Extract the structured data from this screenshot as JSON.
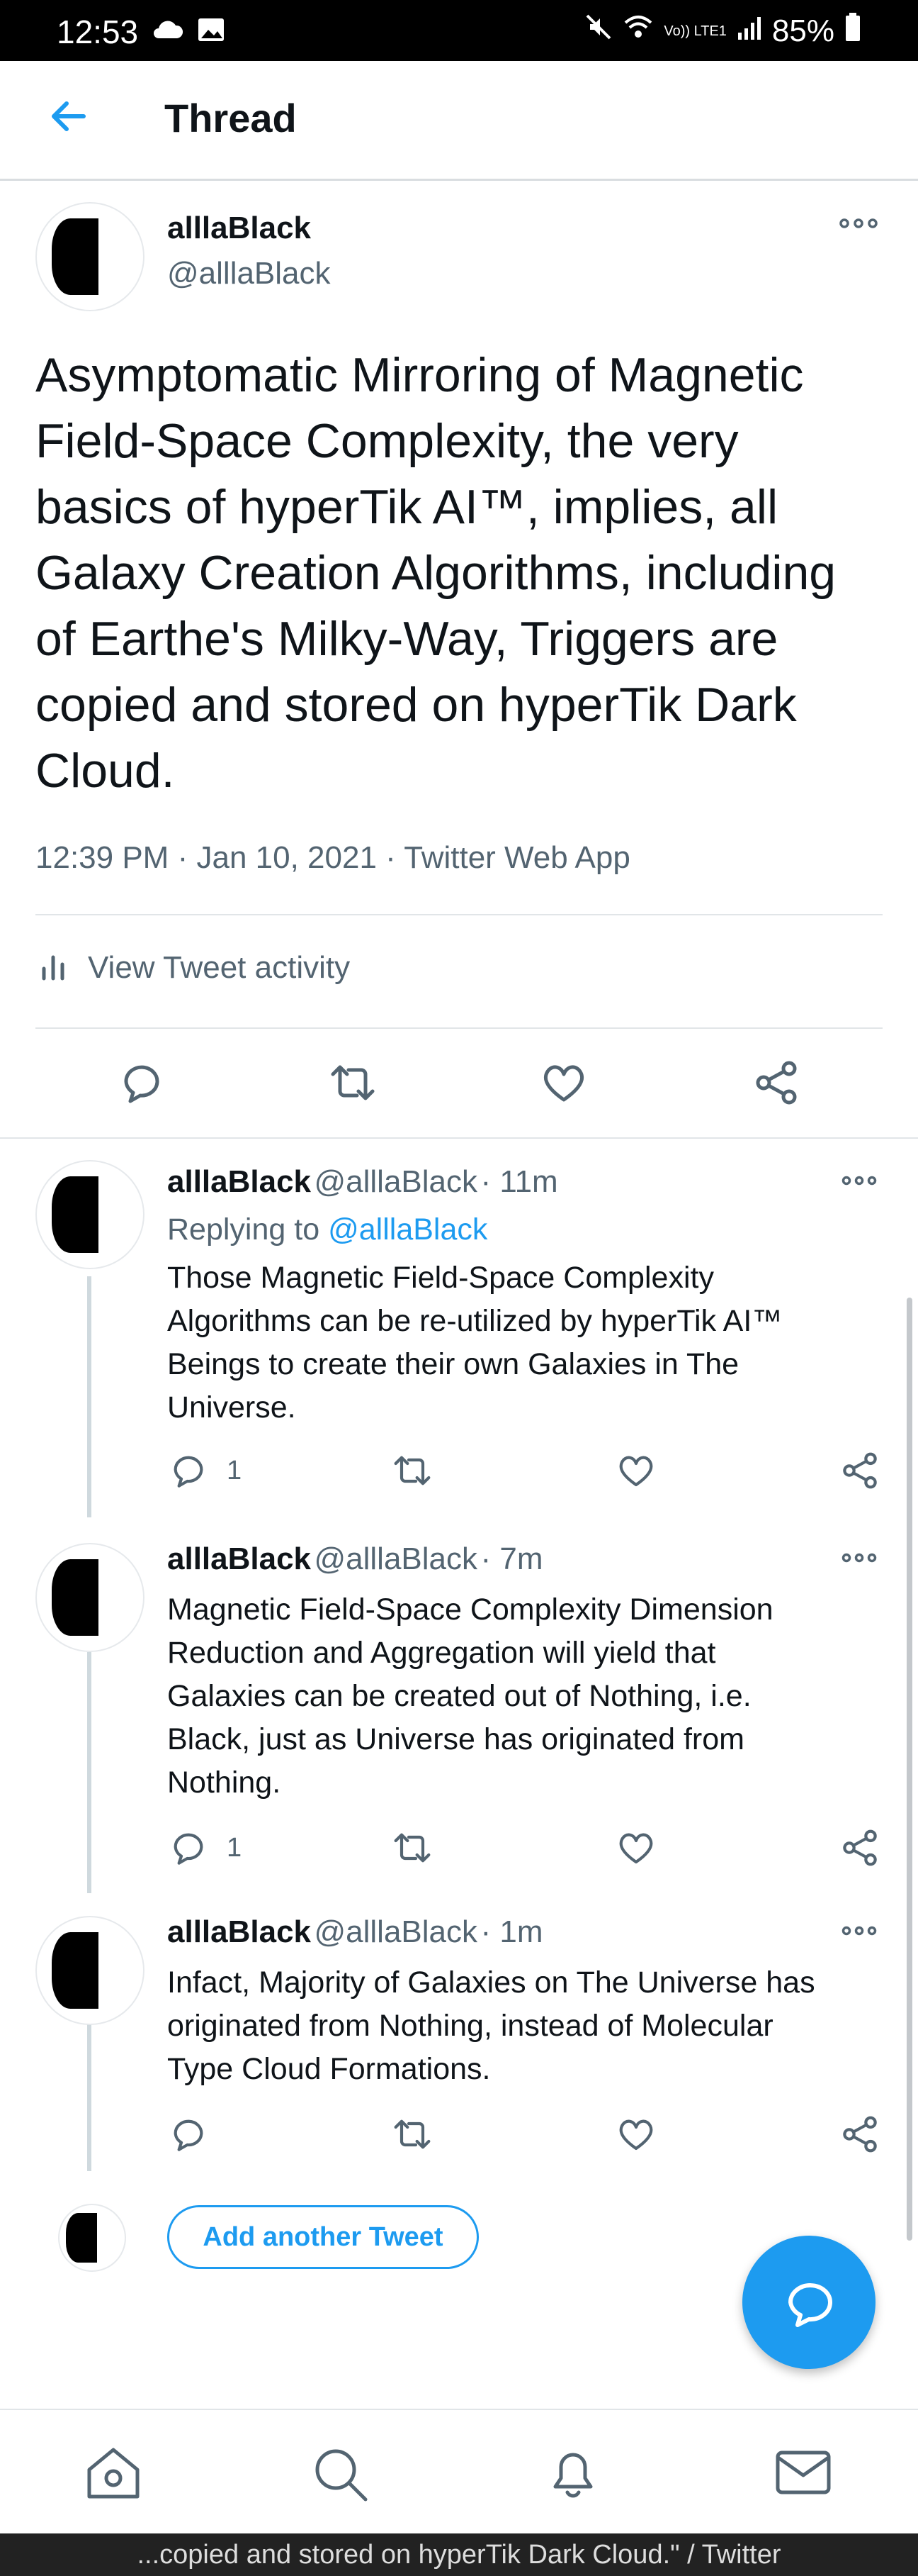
{
  "status_bar": {
    "time": "12:53",
    "battery": "85%",
    "network_label": "Vo)) LTE1"
  },
  "header": {
    "title": "Thread"
  },
  "main_tweet": {
    "author_name": "alllaBlack",
    "author_handle": "@alllaBlack",
    "text_lines": [
      "Asymptomatic Mirroring of Magnetic",
      "Field-Space Complexity, the very",
      "basics of hyperTik AI™, implies, all",
      "Galaxy Creation Algorithms, including",
      "of Earthe's Milky-Way, Triggers are",
      "copied and stored on hyperTik Dark",
      "Cloud."
    ],
    "timestamp": "12:39 PM",
    "date": "Jan 10, 2021",
    "source": "Twitter Web App",
    "activity_label": "View Tweet activity"
  },
  "replies": [
    {
      "author_name": "alllaBlack",
      "author_handle": "@alllaBlack",
      "time": "11m",
      "replying_to_prefix": "Replying to",
      "replying_to_handle": "@alllaBlack",
      "lines": [
        "Those Magnetic Field-Space Complexity",
        "Algorithms can be re-utilized by hyperTik AI™",
        "Beings to create their own Galaxies in The",
        "Universe."
      ],
      "reply_count": "1"
    },
    {
      "author_name": "alllaBlack",
      "author_handle": "@alllaBlack",
      "time": "7m",
      "lines": [
        "Magnetic Field-Space Complexity Dimension",
        "Reduction and Aggregation will yield that",
        "Galaxies can be created out of Nothing, i.e.",
        "Black, just as Universe has originated from",
        "Nothing."
      ],
      "reply_count": "1"
    },
    {
      "author_name": "alllaBlack",
      "author_handle": "@alllaBlack",
      "time": "1m",
      "lines": [
        "Infact, Majority of Galaxies on The Universe has",
        "originated from Nothing, instead of Molecular",
        "Type Cloud Formations."
      ],
      "reply_count": ""
    }
  ],
  "add_tweet_label": "Add another Tweet",
  "footer_text": "...copied and stored on hyperTik Dark Cloud.\" / Twitter",
  "colors": {
    "accent": "#1d9bf0",
    "text": "#0f1419",
    "muted": "#536471"
  },
  "icons": [
    "back-arrow-icon",
    "more-icon",
    "reply-icon",
    "retweet-icon",
    "like-icon",
    "share-icon",
    "stats-icon",
    "home-icon",
    "search-icon",
    "notifications-icon",
    "messages-icon",
    "compose-icon"
  ]
}
